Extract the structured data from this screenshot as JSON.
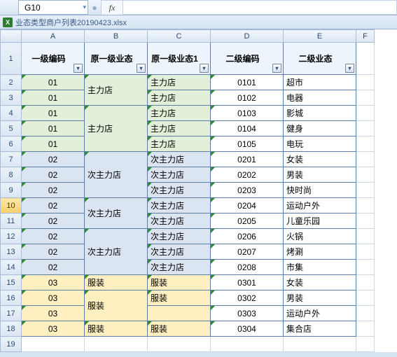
{
  "selected_cell": "G10",
  "selected_row": 10,
  "fx_label": "fx",
  "doc_title": "业态类型商户列表20190423.xlsx",
  "col_letters": [
    "A",
    "B",
    "C",
    "D",
    "E",
    "F"
  ],
  "headers": {
    "A": "一级编码",
    "B": "原一级业态",
    "C": "原一级业态1",
    "D": "二级编码",
    "E": "二级业态"
  },
  "chart_data": {
    "type": "table",
    "columns": [
      "一级编码",
      "原一级业态",
      "原一级业态1",
      "二级编码",
      "二级业态"
    ],
    "rows": [
      [
        "01",
        "主力店",
        "主力店",
        "0101",
        "超市"
      ],
      [
        "01",
        "主力店",
        "主力店",
        "0102",
        "电器"
      ],
      [
        "01",
        "主力店",
        "主力店",
        "0103",
        "影城"
      ],
      [
        "01",
        "主力店",
        "主力店",
        "0104",
        "健身"
      ],
      [
        "01",
        "主力店",
        "主力店",
        "0105",
        "电玩"
      ],
      [
        "02",
        "次主力店",
        "次主力店",
        "0201",
        "女装"
      ],
      [
        "02",
        "次主力店",
        "次主力店",
        "0202",
        "男装"
      ],
      [
        "02",
        "次主力店",
        "次主力店",
        "0203",
        "快时尚"
      ],
      [
        "02",
        "次主力店",
        "次主力店",
        "0204",
        "运动户外"
      ],
      [
        "02",
        "次主力店",
        "次主力店",
        "0205",
        "儿童乐园"
      ],
      [
        "02",
        "次主力店",
        "次主力店",
        "0206",
        "火锅"
      ],
      [
        "02",
        "次主力店",
        "次主力店",
        "0207",
        "烤涮"
      ],
      [
        "02",
        "次主力店",
        "次主力店",
        "0208",
        "市集"
      ],
      [
        "03",
        "服装",
        "服装",
        "0301",
        "女装"
      ],
      [
        "03",
        "服装",
        "服装",
        "0302",
        "男装"
      ],
      [
        "03",
        "服装",
        "",
        "0303",
        "运动户外"
      ],
      [
        "03",
        "服装",
        "服装",
        "0304",
        "集合店"
      ]
    ]
  },
  "merges_B": [
    {
      "start": 2,
      "span": 2,
      "text": "主力店"
    },
    {
      "start": 4,
      "span": 3,
      "text": "主力店"
    },
    {
      "start": 7,
      "span": 3,
      "text": "次主力店"
    },
    {
      "start": 10,
      "span": 2,
      "text": "次主力店"
    },
    {
      "start": 12,
      "span": 3,
      "text": "次主力店"
    },
    {
      "start": 15,
      "span": 1,
      "text": "服装"
    },
    {
      "start": 16,
      "span": 2,
      "text": "服装"
    },
    {
      "start": 18,
      "span": 1,
      "text": "服装"
    }
  ],
  "fill_map": {
    "01": "fill-green",
    "02": "fill-blue",
    "03": "fill-yellow"
  }
}
